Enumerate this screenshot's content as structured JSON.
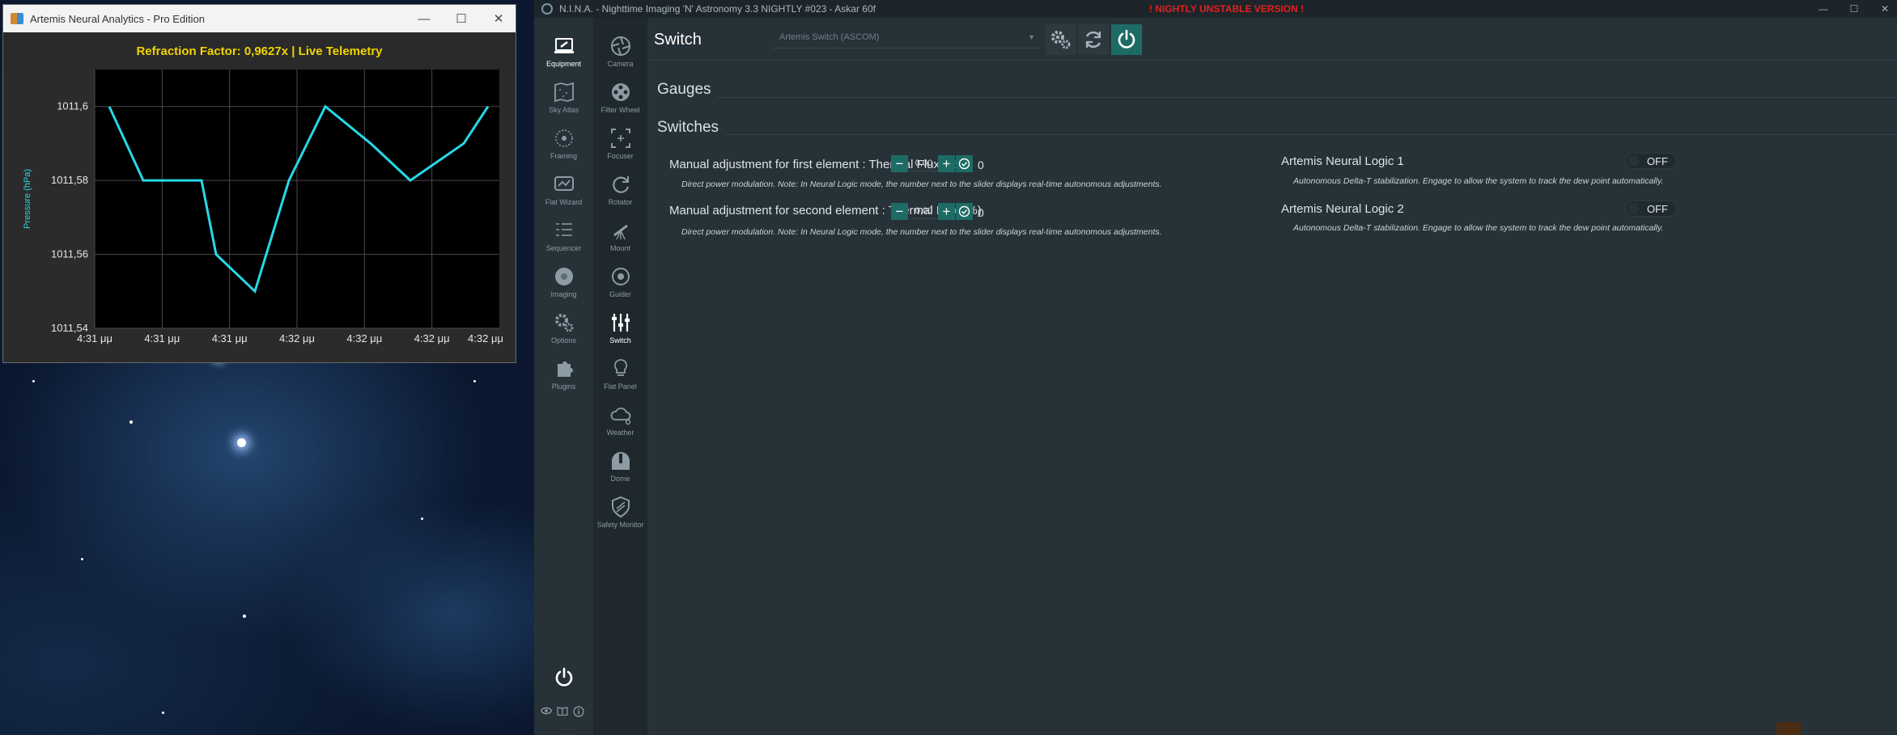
{
  "chart_window": {
    "title": "Artemis Neural Analytics - Pro Edition",
    "header": "Refraction Factor: 0,9627x | Live Telemetry",
    "controls": {
      "minimize": "—",
      "maximize": "☐",
      "close": "✕"
    }
  },
  "chart_data": {
    "type": "line",
    "x": [
      "4:31 μμ",
      "4:31 μμ",
      "4:31 μμ",
      "4:32 μμ",
      "4:32 μμ",
      "4:32 μμ"
    ],
    "ylabel": "Pressure (hPa)",
    "yticks": [
      "1011,6",
      "1011,58",
      "1011,56",
      "1011,54"
    ],
    "ylim": [
      1011.54,
      1011.61
    ],
    "grid": true,
    "series": [
      {
        "values": [
          1011.6,
          1011.58,
          1011.58,
          1011.56,
          1011.55,
          1011.58,
          1011.6,
          1011.59,
          1011.58,
          1011.59,
          1011.6
        ],
        "color": "#27d8e6"
      }
    ]
  },
  "nina": {
    "title": "N.I.N.A. - Nighttime Imaging 'N' Astronomy 3.3 NIGHTLY #023  -  Askar 60f",
    "warning": "! NIGHTLY UNSTABLE VERSION !",
    "main_nav": [
      {
        "label": "Equipment",
        "icon": "equipment-icon"
      },
      {
        "label": "Sky Atlas",
        "icon": "sky-atlas-icon"
      },
      {
        "label": "Framing",
        "icon": "framing-icon"
      },
      {
        "label": "Flat Wizard",
        "icon": "flat-wizard-icon"
      },
      {
        "label": "Sequencer",
        "icon": "sequencer-icon"
      },
      {
        "label": "Imaging",
        "icon": "imaging-icon"
      },
      {
        "label": "Options",
        "icon": "options-icon"
      },
      {
        "label": "Plugins",
        "icon": "plugins-icon"
      }
    ],
    "equipment_nav": [
      {
        "label": "Camera",
        "icon": "camera-icon"
      },
      {
        "label": "Filter Wheel",
        "icon": "filter-wheel-icon"
      },
      {
        "label": "Focuser",
        "icon": "focuser-icon"
      },
      {
        "label": "Rotator",
        "icon": "rotator-icon"
      },
      {
        "label": "Mount",
        "icon": "mount-icon"
      },
      {
        "label": "Guider",
        "icon": "guider-icon"
      },
      {
        "label": "Switch",
        "icon": "switch-icon"
      },
      {
        "label": "Flat Panel",
        "icon": "flat-panel-icon"
      },
      {
        "label": "Weather",
        "icon": "weather-icon"
      },
      {
        "label": "Dome",
        "icon": "dome-icon"
      },
      {
        "label": "Safety Monitor",
        "icon": "safety-monitor-icon"
      }
    ],
    "collapse_label": "<<",
    "page_title": "Switch",
    "device": "Artemis Switch (ASCOM)",
    "sections": {
      "gauges": "Gauges",
      "switches": "Switches"
    },
    "switches_left": [
      {
        "name": "Manual adjustment for first element : Thermal Flux (%)",
        "value": "0,00",
        "current": "0",
        "description": "Direct power modulation. Note: In Neural Logic mode, the number next to the slider displays real-time autonomous adjustments."
      },
      {
        "name": "Manual adjustment for second element : Thermal Flux (%)",
        "value": "0,00",
        "current": "0",
        "description": "Direct power modulation. Note: In Neural Logic mode, the number next to the slider displays real-time autonomous adjustments."
      }
    ],
    "switches_right": [
      {
        "name": "Artemis Neural Logic 1",
        "state": "OFF",
        "description": "Autonomous Delta-T stabilization. Engage to allow the system to track the dew point automatically."
      },
      {
        "name": "Artemis Neural Logic 2",
        "state": "OFF",
        "description": "Autonomous Delta-T stabilization. Engage to allow the system to track the dew point automatically."
      }
    ],
    "accent_color": "#1e6b66"
  }
}
